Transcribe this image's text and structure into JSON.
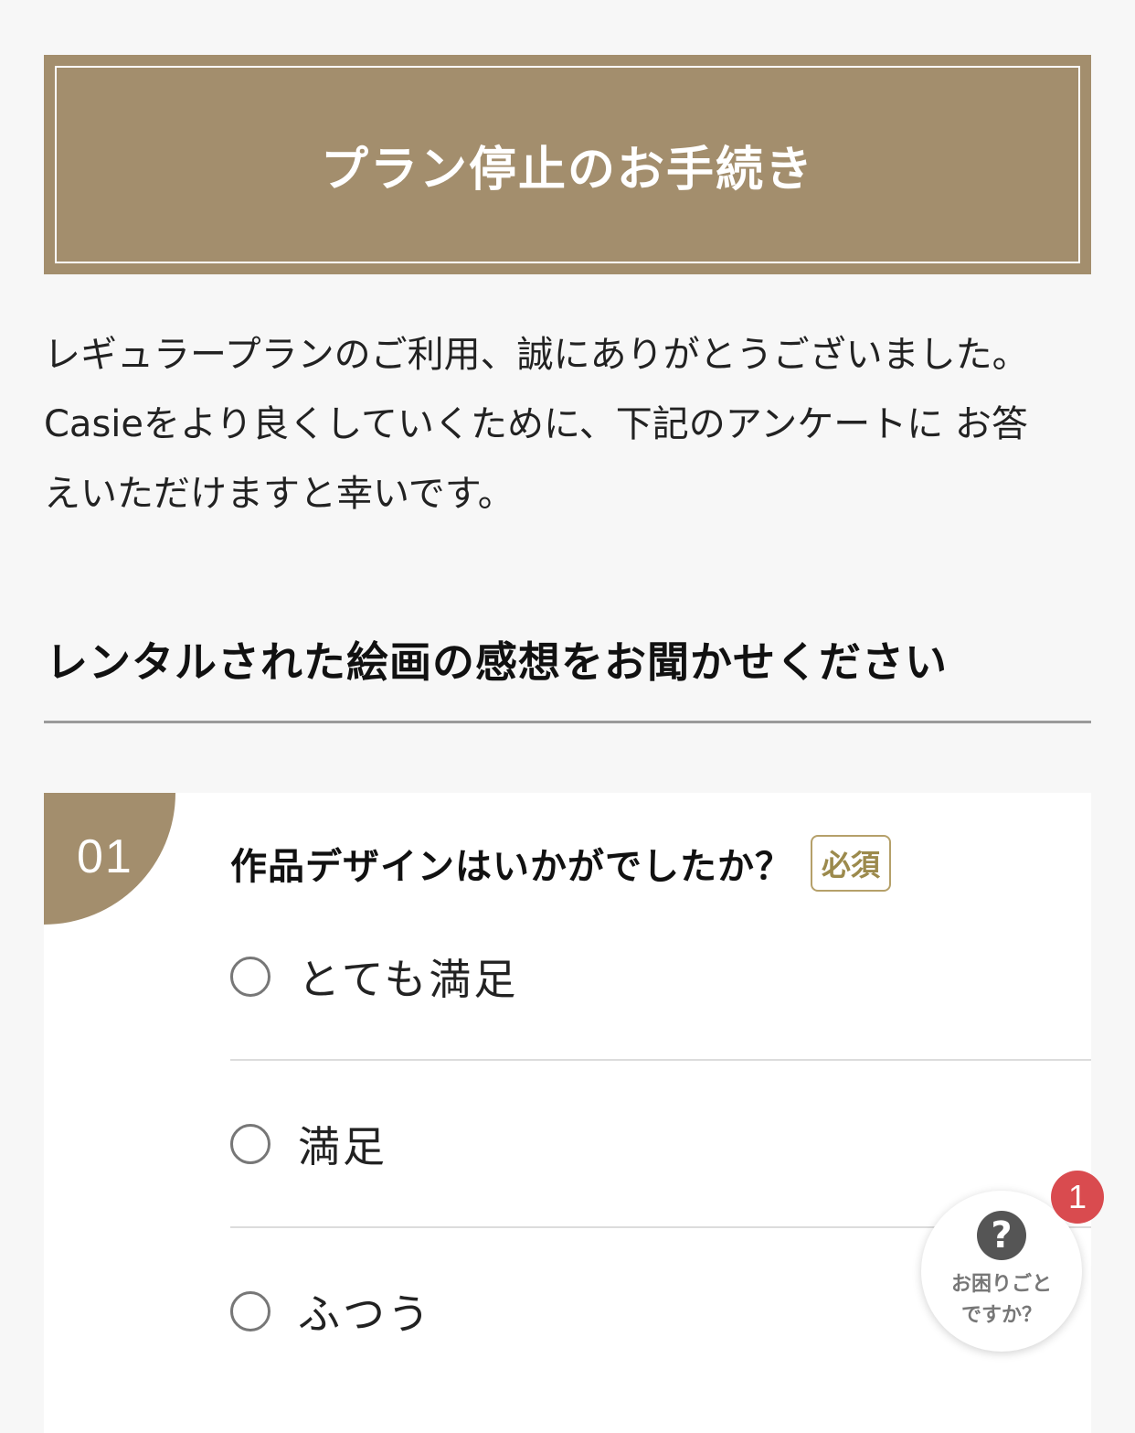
{
  "header": {
    "title": "プラン停止のお手続き"
  },
  "intro": {
    "line1": "レギュラープランのご利用、誠にありがとうございました。",
    "line2": "Casieをより良くしていくために、下記のアンケートに お答",
    "line3": "えいただけますと幸いです。"
  },
  "section": {
    "heading": "レンタルされた絵画の感想をお聞かせください"
  },
  "question": {
    "number": "01",
    "title": "作品デザインはいかがでしたか？",
    "required_label": "必須",
    "options": [
      {
        "label": "とても満足"
      },
      {
        "label": "満足"
      },
      {
        "label": "ふつう"
      }
    ]
  },
  "help_widget": {
    "icon": "question-circle-icon",
    "line1": "お困りごと",
    "line2": "ですか？",
    "badge_count": "1"
  },
  "colors": {
    "brand": "#a38e6d",
    "badge_red": "#d94b4f",
    "required_gold": "#9c8a4c"
  }
}
